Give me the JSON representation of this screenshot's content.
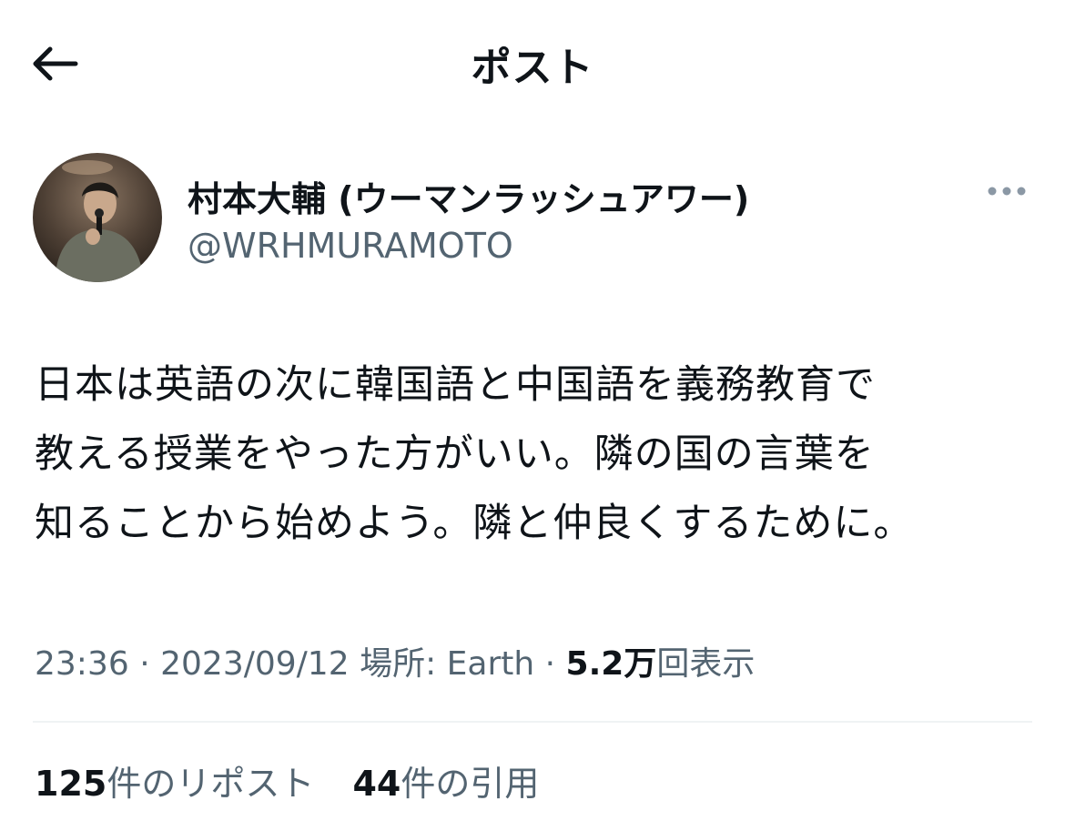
{
  "header": {
    "title": "ポスト",
    "back_icon": "arrow-left-icon"
  },
  "author": {
    "display_name": "村本大輔 (ウーマンラッシュアワー)",
    "handle": "@WRHMURAMOTO",
    "more_icon": "more-horizontal-icon"
  },
  "tweet": {
    "lines": [
      "日本は英語の次に韓国語と中国語を義務教育で",
      "教える授業をやった方がいい。隣の国の言葉を",
      "知ることから始めよう。隣と仲良くするために。"
    ]
  },
  "meta": {
    "time": "23:36",
    "sep1": "·",
    "date": "2023/09/12",
    "location": "場所: Earth",
    "sep2": "·",
    "views_count": "5.2万",
    "views_label": "回表示"
  },
  "stats": {
    "reposts_count": "125",
    "reposts_label": "件のリポスト",
    "quotes_count": "44",
    "quotes_label": "件の引用"
  },
  "colors": {
    "text_primary": "#0f1419",
    "text_secondary": "#536471",
    "divider": "#eff3f4"
  }
}
